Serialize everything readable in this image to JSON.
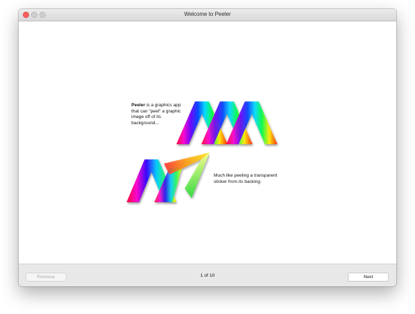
{
  "window": {
    "title": "Welcome to Peeler"
  },
  "slide": {
    "app_name": "Peeler",
    "text1_rest": " is a graphics app that can \"peel\" a graphic image off of its background...",
    "text2": "Much like peeling a transparent sticker from its backing."
  },
  "footer": {
    "previous_label": "Previous",
    "page_indicator": "1 of 10",
    "next_label": "Next"
  },
  "colors": {
    "close": "#fc605c",
    "footer_bg": "#e8e8e8"
  }
}
